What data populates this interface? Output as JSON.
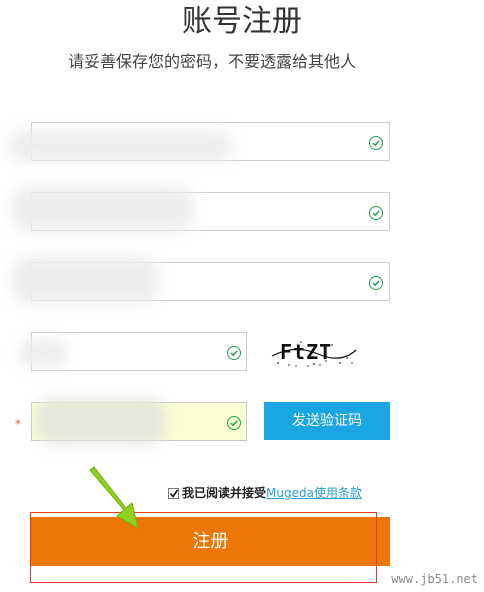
{
  "page": {
    "title": "账号注册",
    "subtitle": "请妥善保存您的密码，不要透露给其他人"
  },
  "form": {
    "captcha_text": "FtZT",
    "send_code_label": "发送验证码",
    "required_mark": "*",
    "agree_prefix": "我已阅读并接受",
    "agree_link": "Mugeda使用条款",
    "agree_checked": true,
    "submit_label": "注册"
  },
  "watermark": "www.jb51.net",
  "colors": {
    "submit": "#ee7606",
    "send_code": "#1aa6e2",
    "valid_check": "#22a04a",
    "link": "#2aa0d8"
  },
  "icons": {
    "valid": "check-circle-icon",
    "annotation": "green-arrow-icon"
  }
}
